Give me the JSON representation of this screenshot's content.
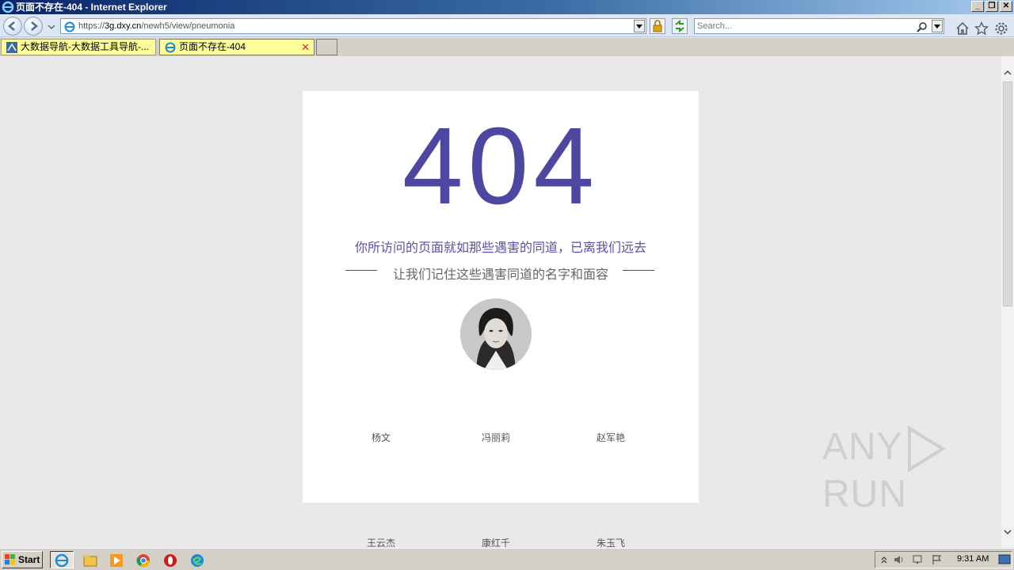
{
  "window": {
    "title": "页面不存在-404 - Internet Explorer",
    "buttons": [
      "_",
      "❐",
      "✕"
    ]
  },
  "address": {
    "scheme": "https://",
    "host": "3g.dxy.cn",
    "path": "/newh5/view/pneumonia"
  },
  "search": {
    "placeholder": "Search..."
  },
  "tabs": [
    {
      "label": "大数据导航-大数据工具导航-...",
      "active": false
    },
    {
      "label": "页面不存在-404",
      "active": true
    }
  ],
  "page": {
    "code": "404",
    "message": "你所访问的页面就如那些遇害的同道，已离我们远去",
    "tagline": "让我们记住这些遇害同道的名字和面容",
    "names_row1": [
      "杨文",
      "冯丽莉",
      "赵军艳"
    ],
    "names_row2": [
      "王云杰",
      "康红千",
      "朱玉飞"
    ]
  },
  "watermark": {
    "left": "ANY",
    "right": "RUN"
  },
  "taskbar": {
    "start_label": "Start",
    "clock": "9:31 AM"
  },
  "colors": {
    "accent": "#4e47a2",
    "titlebar": "#0a246a",
    "tab_active": "#fdfd9a"
  }
}
